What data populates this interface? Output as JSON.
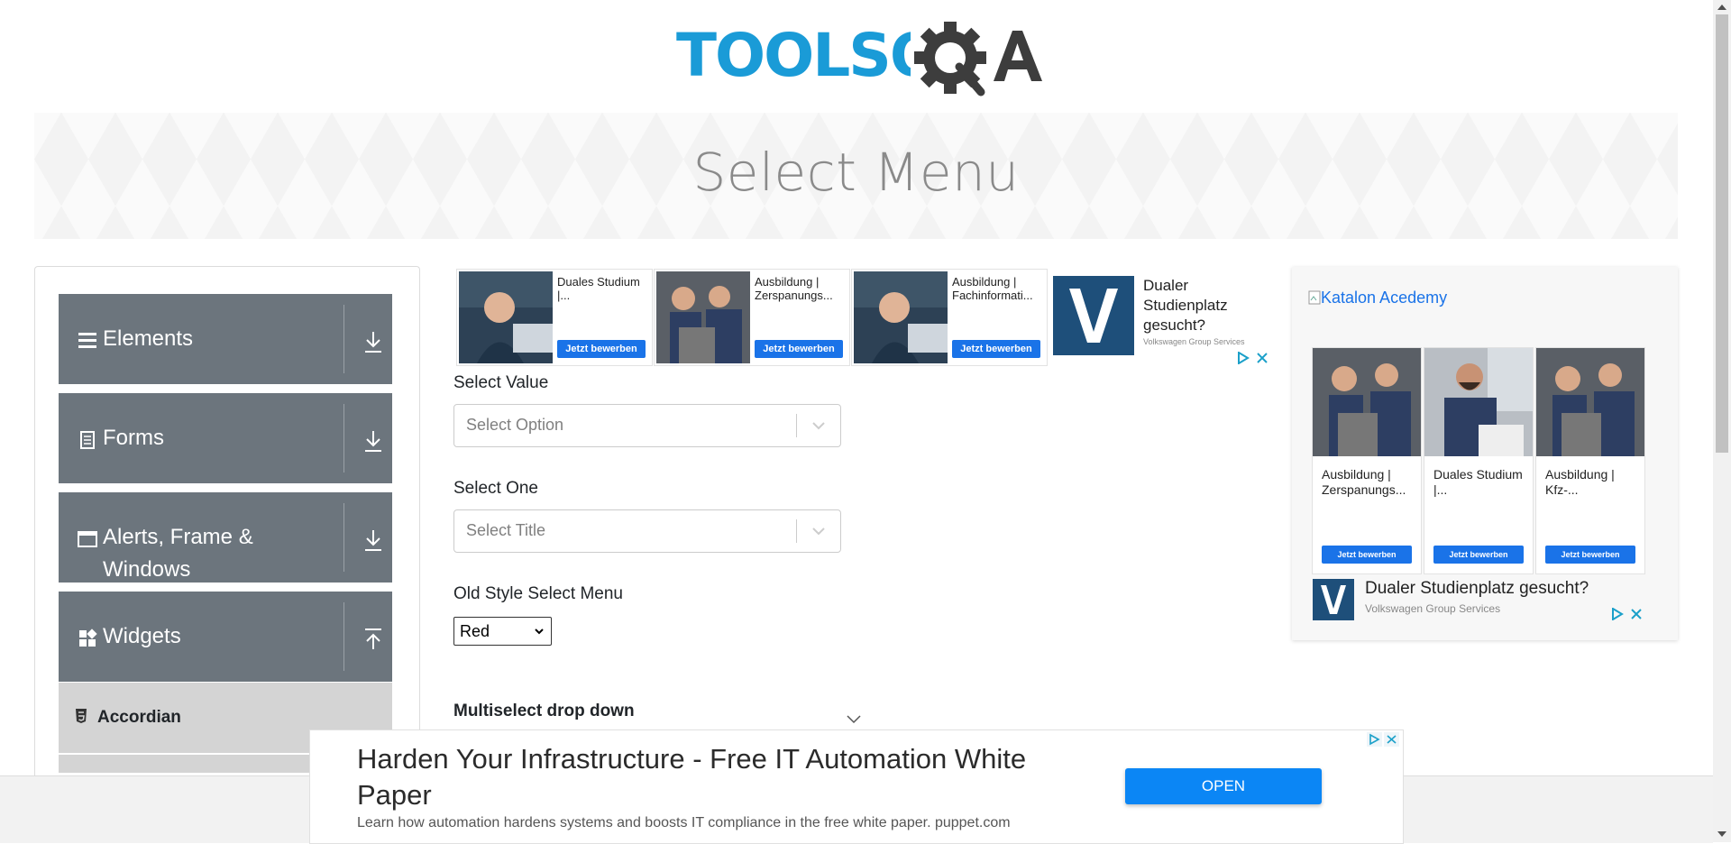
{
  "header": {
    "logo_text": "TOOLSQA"
  },
  "banner": {
    "title": "Select Menu"
  },
  "sidebar": {
    "groups": [
      {
        "label": "Elements",
        "icon": "list-icon",
        "expanded": false
      },
      {
        "label": "Forms",
        "icon": "document-icon",
        "expanded": false
      },
      {
        "label": "Alerts, Frame & Windows",
        "icon": "window-icon",
        "expanded": false
      },
      {
        "label": "Widgets",
        "icon": "widgets-icon",
        "expanded": true
      }
    ],
    "items": [
      {
        "label": "Accordian",
        "icon": "html5-icon"
      }
    ]
  },
  "top_ads": {
    "cards": [
      {
        "text": "Duales Studium |...",
        "button": "Jetzt bewerben"
      },
      {
        "text": "Ausbildung | Zerspanungs...",
        "button": "Jetzt bewerben"
      },
      {
        "text": "Ausbildung | Fachinformati...",
        "button": "Jetzt bewerben"
      }
    ],
    "vw_text": "Dualer Studienplatz gesucht?",
    "vw_sub": "Volkswagen Group Services"
  },
  "form": {
    "select_value_label": "Select Value",
    "select_value_placeholder": "Select Option",
    "select_one_label": "Select One",
    "select_one_placeholder": "Select Title",
    "old_style_label": "Old Style Select Menu",
    "old_style_value": "Red",
    "multiselect_label": "Multiselect drop down"
  },
  "right_ad": {
    "katalon_alt": "Katalon Acedemy",
    "cards": [
      {
        "text": "Ausbildung | Zerspanungs...",
        "button": "Jetzt bewerben"
      },
      {
        "text": "Duales Studium |...",
        "button": "Jetzt bewerben"
      },
      {
        "text": "Ausbildung | Kfz-...",
        "button": "Jetzt bewerben"
      }
    ],
    "vw_text": "Dualer Studienplatz gesucht?",
    "vw_sub": "Volkswagen Group Services"
  },
  "bottom_ad": {
    "title": "Harden Your Infrastructure - Free IT Automation White Paper",
    "description": "Learn how automation hardens systems and boosts IT compliance in the free white paper. puppet.com",
    "button": "OPEN"
  },
  "colors": {
    "brand_blue": "#1a9bd7",
    "brand_dark": "#3d3d3d",
    "sidebar_bg": "#6c757d",
    "ad_button": "#1a73e8"
  }
}
